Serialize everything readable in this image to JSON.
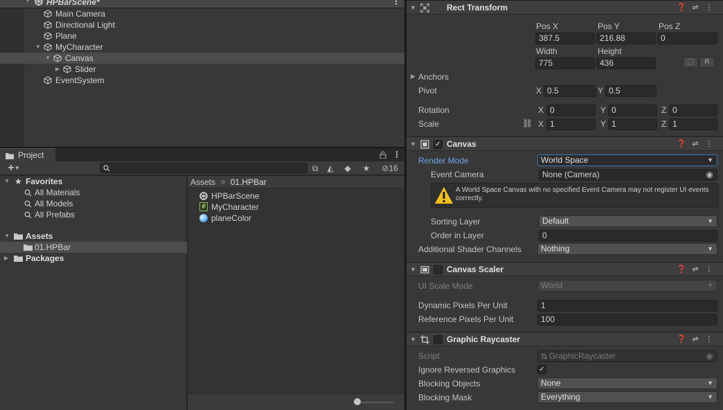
{
  "hierarchy": {
    "scene_name": "HPBarScene*",
    "items": [
      {
        "label": "Main Camera"
      },
      {
        "label": "Directional Light"
      },
      {
        "label": "Plane"
      },
      {
        "label": "MyCharacter"
      },
      {
        "label": "Canvas"
      },
      {
        "label": "Slider"
      },
      {
        "label": "EventSystem"
      }
    ]
  },
  "project": {
    "tab_label": "Project",
    "toolbar": {
      "add_label": "+",
      "hidden_count": "16",
      "search_placeholder": ""
    },
    "favorites": {
      "label": "Favorites",
      "items": [
        {
          "label": "All Materials"
        },
        {
          "label": "All Models"
        },
        {
          "label": "All Prefabs"
        }
      ]
    },
    "tree": {
      "assets_label": "Assets",
      "subfolder_label": "01.HPBar",
      "packages_label": "Packages"
    },
    "breadcrumb": {
      "root": "Assets",
      "separator": ">",
      "current": "01.HPBar"
    },
    "files": [
      {
        "label": "HPBarScene",
        "icon": "unity-scene-icon"
      },
      {
        "label": "MyCharacter",
        "icon": "csharp-script-icon"
      },
      {
        "label": "planeColor",
        "icon": "material-icon"
      }
    ]
  },
  "inspector": {
    "rect_transform": {
      "title": "Rect Transform",
      "pos_x_label": "Pos X",
      "pos_y_label": "Pos Y",
      "pos_z_label": "Pos Z",
      "pos_x": "387.5",
      "pos_y": "216.88",
      "pos_z": "0",
      "width_label": "Width",
      "height_label": "Height",
      "width": "775",
      "height": "436",
      "r_button": "R",
      "anchors_label": "Anchors",
      "pivot_label": "Pivot",
      "pivot_x": "0.5",
      "pivot_y": "0.5",
      "rotation_label": "Rotation",
      "rot_x": "0",
      "rot_y": "0",
      "rot_z": "0",
      "scale_label": "Scale",
      "scale_x": "1",
      "scale_y": "1",
      "scale_z": "1",
      "axis_x": "X",
      "axis_y": "Y",
      "axis_z": "Z"
    },
    "canvas": {
      "title": "Canvas",
      "render_mode_label": "Render Mode",
      "render_mode": "World Space",
      "event_camera_label": "Event Camera",
      "event_camera": "None (Camera)",
      "warning": "A World Space Canvas with no specified Event Camera may not register UI events correctly.",
      "sorting_layer_label": "Sorting Layer",
      "sorting_layer": "Default",
      "order_label": "Order in Layer",
      "order": "0",
      "shader_channels_label": "Additional Shader Channels",
      "shader_channels": "Nothing"
    },
    "canvas_scaler": {
      "title": "Canvas Scaler",
      "scale_mode_label": "UI Scale Mode",
      "scale_mode": "World",
      "dynamic_label": "Dynamic Pixels Per Unit",
      "dynamic": "1",
      "reference_label": "Reference Pixels Per Unit",
      "reference": "100"
    },
    "graphic_raycaster": {
      "title": "Graphic Raycaster",
      "script_label": "Script",
      "script": "GraphicRaycaster",
      "ignore_label": "Ignore Reversed Graphics",
      "blocking_objects_label": "Blocking Objects",
      "blocking_objects": "None",
      "blocking_mask_label": "Blocking Mask",
      "blocking_mask": "Everything"
    }
  }
}
